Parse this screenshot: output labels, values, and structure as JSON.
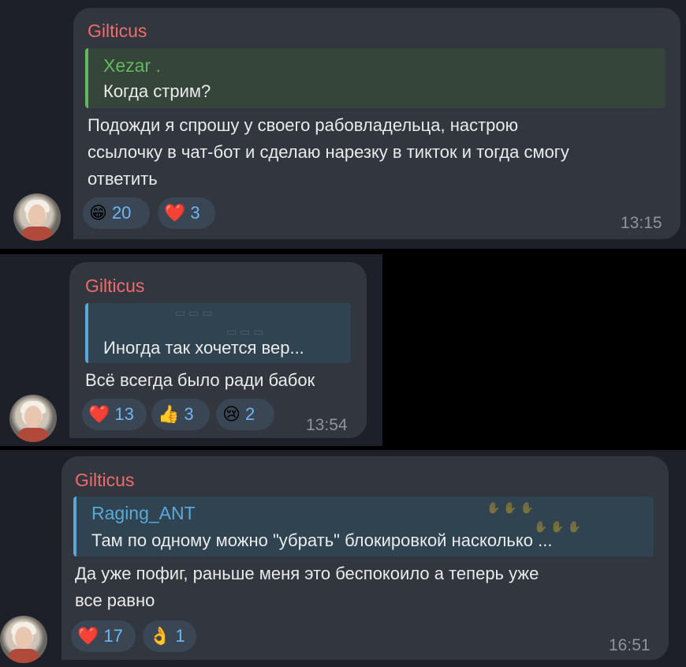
{
  "messages": [
    {
      "author": "Gilticus",
      "reply": {
        "name": "Xezar .",
        "text": "Когда стрим?"
      },
      "lines": [
        "Подожди я спрошу у своего рабовладельца, настрою",
        "ссылочку в чат-бот и сделаю нарезку в тикток и тогда смогу",
        "ответить"
      ],
      "reactions": [
        {
          "icon": "grinning-face-icon",
          "emoji": "😁",
          "count": "20"
        },
        {
          "icon": "heart-icon",
          "emoji": "❤️",
          "count": "3"
        }
      ],
      "time": "13:15"
    },
    {
      "author": "Gilticus",
      "reply": {
        "name": "",
        "text": "Иногда так хочется вер..."
      },
      "lines": [
        "Всё всегда было ради бабок"
      ],
      "reactions": [
        {
          "icon": "heart-icon",
          "emoji": "❤️",
          "count": "13"
        },
        {
          "icon": "thumbs-up-icon",
          "emoji": "👍",
          "count": "3"
        },
        {
          "icon": "crying-face-icon",
          "emoji": "😢",
          "count": "2"
        }
      ],
      "time": "13:54"
    },
    {
      "author": "Gilticus",
      "reply": {
        "name": "Raging_ANT",
        "text": "Там по одному можно \"убрать\" блокировкой насколько ..."
      },
      "lines": [
        "Да уже пофиг, раньше меня это беспокоило а теперь уже",
        "все равно"
      ],
      "reactions": [
        {
          "icon": "heart-icon",
          "emoji": "❤️",
          "count": "17"
        },
        {
          "icon": "ok-hand-icon",
          "emoji": "👌",
          "count": "1"
        }
      ],
      "time": "16:51"
    }
  ],
  "colors": {
    "author": "#f06b6b",
    "reply_green": "#62b860",
    "reply_blue": "#5aa8d8",
    "reaction_count": "#6fb6f0"
  }
}
